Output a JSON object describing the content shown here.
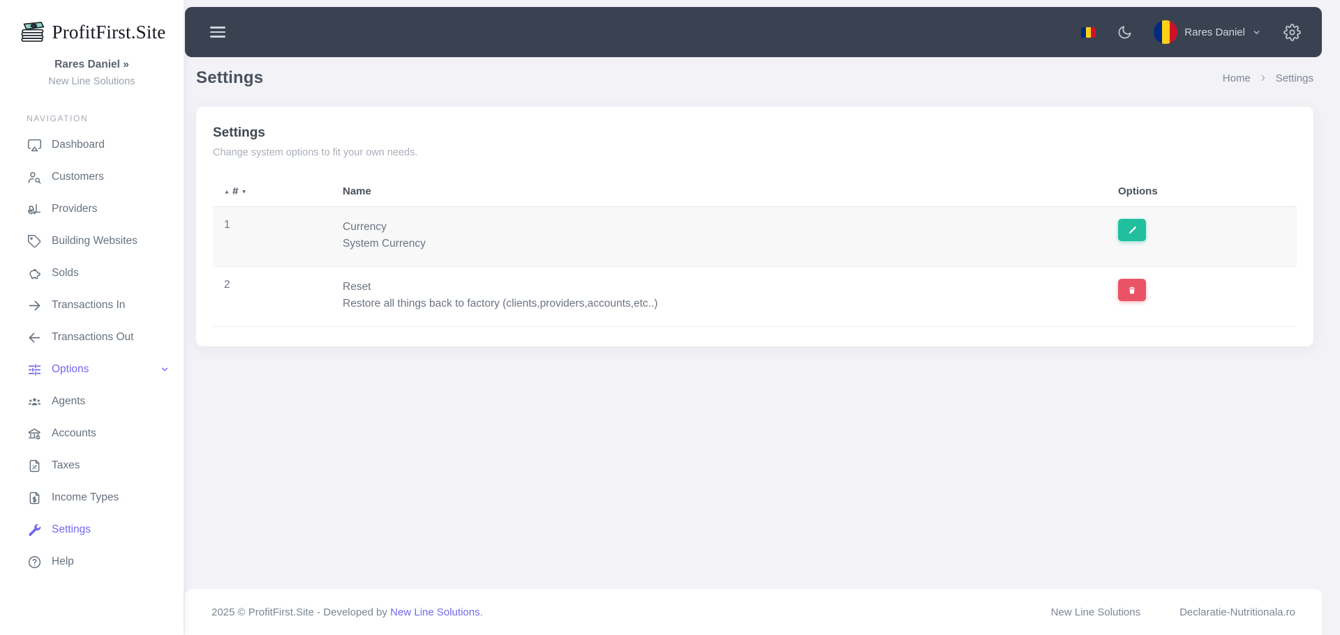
{
  "brand": {
    "site_name": "ProfitFirst.Site",
    "owner": "Rares Daniel »",
    "company": "New Line Solutions"
  },
  "sidebar": {
    "section_label": "NAVIGATION",
    "items": [
      {
        "label": "Dashboard",
        "icon": "dashboard-icon",
        "active": false
      },
      {
        "label": "Customers",
        "icon": "customer-search-icon",
        "active": false
      },
      {
        "label": "Providers",
        "icon": "forklift-icon",
        "active": false
      },
      {
        "label": "Building Websites",
        "icon": "tag-icon",
        "active": false
      },
      {
        "label": "Solds",
        "icon": "piggy-bank-icon",
        "active": false
      },
      {
        "label": "Transactions In",
        "icon": "arrow-right-icon",
        "active": false
      },
      {
        "label": "Transactions Out",
        "icon": "arrow-left-icon",
        "active": false
      },
      {
        "label": "Options",
        "icon": "sliders-icon",
        "active": true,
        "expanded": true
      },
      {
        "label": "Agents",
        "icon": "people-group-icon",
        "active": false
      },
      {
        "label": "Accounts",
        "icon": "bank-icon",
        "active": false
      },
      {
        "label": "Taxes",
        "icon": "file-percent-icon",
        "active": false
      },
      {
        "label": "Income Types",
        "icon": "file-dollar-icon",
        "active": false
      },
      {
        "label": "Settings",
        "icon": "wrench-icon",
        "active": true
      },
      {
        "label": "Help",
        "icon": "help-circle-icon",
        "active": false
      }
    ]
  },
  "topbar": {
    "user_name": "Rares Daniel",
    "language_flag": "romania",
    "avatar_flag": "romania"
  },
  "page": {
    "title": "Settings",
    "breadcrumb": {
      "home": "Home",
      "current": "Settings"
    }
  },
  "card": {
    "title": "Settings",
    "subtitle": "Change system options to fit your own needs.",
    "table": {
      "headers": {
        "id": "#",
        "name": "Name",
        "options": "Options"
      },
      "rows": [
        {
          "id": "1",
          "name": "Currency",
          "description": "System Currency",
          "action": "edit"
        },
        {
          "id": "2",
          "name": "Reset",
          "description": "Restore all things back to factory (clients,providers,accounts,etc..)",
          "action": "delete"
        }
      ]
    }
  },
  "footer": {
    "copyright_prefix": "2025 © ProfitFirst.Site - Developed by ",
    "copyright_link": "New Line Solutions",
    "copyright_suffix": ".",
    "links": [
      {
        "label": "New Line Solutions"
      },
      {
        "label": "Declaratie-Nutritionala.ro"
      }
    ]
  },
  "colors": {
    "accent_purple": "#7467ef",
    "navbar_bg": "#3a4252",
    "edit_green": "#21bf9e",
    "delete_red": "#ea5366",
    "flag_blue": "#002b7f",
    "flag_yellow": "#fcd116",
    "flag_red": "#ce1126"
  }
}
